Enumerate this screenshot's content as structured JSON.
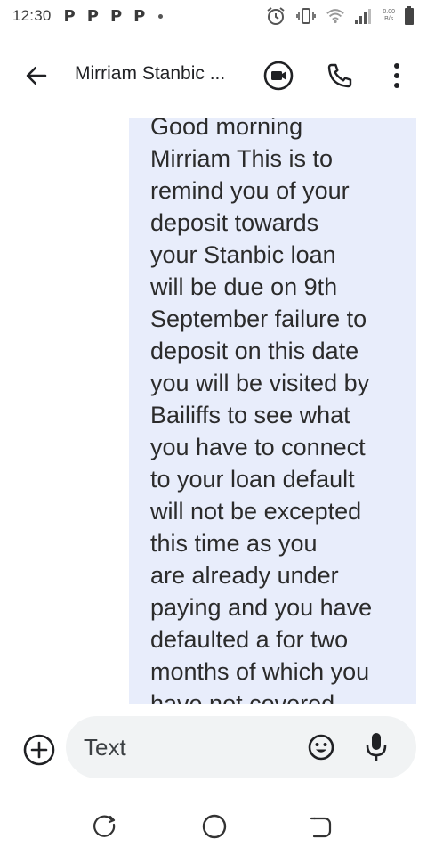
{
  "status_bar": {
    "time": "12:30",
    "notifications": [
      "P",
      "P",
      "P",
      "P"
    ],
    "net_speed_value": "0.00",
    "net_speed_unit": "B/s",
    "icons": [
      "alarm-icon",
      "vibrate-icon",
      "wifi-icon",
      "signal-icon",
      "battery-icon"
    ]
  },
  "app_bar": {
    "contact_name": "Mirriam Stanbic ...",
    "icons": [
      "back-arrow-icon",
      "video-call-icon",
      "phone-icon",
      "more-vert-icon"
    ]
  },
  "thread": {
    "messages": [
      {
        "direction": "incoming",
        "text": "Good morning\nMirriam This is to\nremind you of your\ndeposit towards\nyour Stanbic loan\nwill be due on 9th\nSeptember failure to\ndeposit on this date\nyou will be visited by\nBailiffs to see what\nyou have to connect\nto your loan default\nwill not be excepted\nthis time as you\nare already under\npaying and you have\ndefaulted a for two\nmonths of which you\nhave not covered."
      }
    ],
    "bubble_color": "#e8edfb"
  },
  "compose": {
    "placeholder": "Text",
    "icons": [
      "add-circle-icon",
      "emoji-icon",
      "mic-icon"
    ]
  },
  "nav_bar": {
    "icons": [
      "recents-icon",
      "home-icon",
      "back-icon"
    ]
  }
}
